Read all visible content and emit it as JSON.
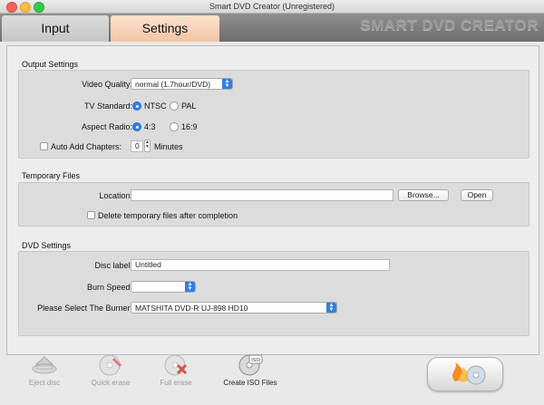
{
  "window": {
    "title": "Smart DVD Creator (Unregistered)"
  },
  "tabs": {
    "input": "Input",
    "settings": "Settings"
  },
  "brand": "SMART DVD CREATOR",
  "output_settings": {
    "title": "Output Settings",
    "video_quality_label": "Video Quality:",
    "video_quality_value": "normal (1.7hour/DVD)",
    "tv_standard_label": "TV Standard:",
    "tv_ntsc": "NTSC",
    "tv_pal": "PAL",
    "aspect_label": "Aspect Radio:",
    "aspect_43": "4:3",
    "aspect_169": "16:9",
    "auto_chapters_label": "Auto Add Chapters:",
    "chapters_value": "0",
    "minutes_label": "Minutes"
  },
  "temporary_files": {
    "title": "Temporary Files",
    "location_label": "Location:",
    "location_value": "",
    "browse_label": "Browse...",
    "open_label": "Open",
    "delete_label": "Delete temporary files after completion"
  },
  "dvd_settings": {
    "title": "DVD Settings",
    "disc_label_label": "Disc label:",
    "disc_label_value": "Untitled",
    "burn_speed_label": "Burn Speed:",
    "burn_speed_value": "",
    "burner_label": "Please Select The Burner:",
    "burner_value": "MATSHITA DVD-R   UJ-898   HD10"
  },
  "toolbar": {
    "eject": "Eject disc",
    "quick_erase": "Quick erase",
    "full_erase": "Full erase",
    "create_iso": "Create ISO Files",
    "iso_badge": "ISO"
  },
  "colors": {
    "accent": "#2f7fe6",
    "settings_tab": "#f6d2b9"
  }
}
